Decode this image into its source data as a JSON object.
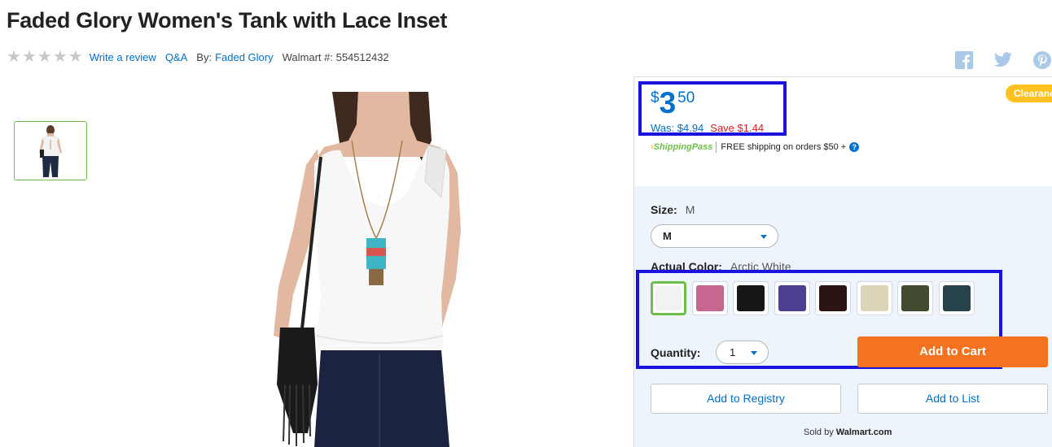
{
  "product": {
    "title": "Faded Glory Women's Tank with Lace Inset",
    "rating_stars": 0,
    "write_review": "Write a review",
    "qa": "Q&A",
    "by_label": "By:",
    "brand": "Faded Glory",
    "walmart_number": "Walmart #: 554512432"
  },
  "social": [
    "facebook-icon",
    "twitter-icon",
    "pinterest-icon"
  ],
  "price": {
    "currency": "$",
    "dollars": "3",
    "cents": "50",
    "was": "Was: $4.94",
    "save": "Save $1.44",
    "badge": "Clearance"
  },
  "shipping": {
    "logo": "ShippingPass",
    "text": "FREE shipping on orders $50 +",
    "help": "?"
  },
  "size": {
    "label": "Size:",
    "value": "M",
    "selected": "M"
  },
  "color": {
    "label": "Actual Color:",
    "value": "Arctic White",
    "swatches": [
      {
        "name": "Arctic White",
        "hex": "#f2f2f2",
        "selected": true
      },
      {
        "name": "pink",
        "hex": "#c7678f"
      },
      {
        "name": "black",
        "hex": "#161616"
      },
      {
        "name": "purple",
        "hex": "#4c3f90"
      },
      {
        "name": "dark brown",
        "hex": "#2c1414"
      },
      {
        "name": "tan",
        "hex": "#dcd4b6"
      },
      {
        "name": "olive",
        "hex": "#3f4a2e"
      },
      {
        "name": "dark teal",
        "hex": "#26424a"
      }
    ]
  },
  "quantity": {
    "label": "Quantity:",
    "value": "1"
  },
  "buttons": {
    "add_to_cart": "Add to Cart",
    "add_to_registry": "Add to Registry",
    "add_to_list": "Add to List"
  },
  "sold_by": {
    "prefix": "Sold by",
    "seller": "Walmart.com"
  },
  "colors": {
    "link": "#0071ce",
    "cta": "#f47321",
    "save": "#de1c24",
    "highlight": "#1a13e0",
    "selected": "#6cc04a"
  }
}
